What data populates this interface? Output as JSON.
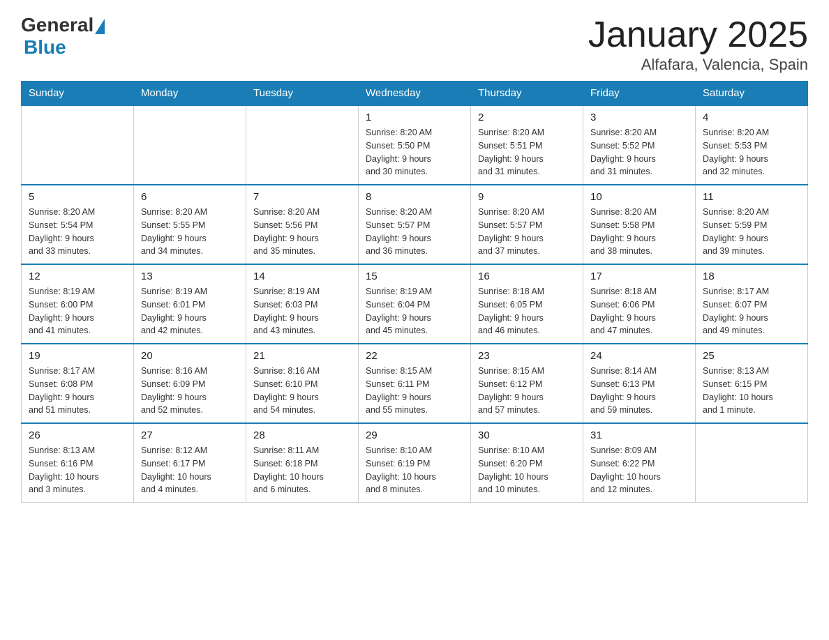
{
  "header": {
    "logo_general": "General",
    "logo_blue": "Blue",
    "title": "January 2025",
    "subtitle": "Alfafara, Valencia, Spain"
  },
  "weekdays": [
    "Sunday",
    "Monday",
    "Tuesday",
    "Wednesday",
    "Thursday",
    "Friday",
    "Saturday"
  ],
  "weeks": [
    [
      {
        "day": "",
        "info": ""
      },
      {
        "day": "",
        "info": ""
      },
      {
        "day": "",
        "info": ""
      },
      {
        "day": "1",
        "info": "Sunrise: 8:20 AM\nSunset: 5:50 PM\nDaylight: 9 hours\nand 30 minutes."
      },
      {
        "day": "2",
        "info": "Sunrise: 8:20 AM\nSunset: 5:51 PM\nDaylight: 9 hours\nand 31 minutes."
      },
      {
        "day": "3",
        "info": "Sunrise: 8:20 AM\nSunset: 5:52 PM\nDaylight: 9 hours\nand 31 minutes."
      },
      {
        "day": "4",
        "info": "Sunrise: 8:20 AM\nSunset: 5:53 PM\nDaylight: 9 hours\nand 32 minutes."
      }
    ],
    [
      {
        "day": "5",
        "info": "Sunrise: 8:20 AM\nSunset: 5:54 PM\nDaylight: 9 hours\nand 33 minutes."
      },
      {
        "day": "6",
        "info": "Sunrise: 8:20 AM\nSunset: 5:55 PM\nDaylight: 9 hours\nand 34 minutes."
      },
      {
        "day": "7",
        "info": "Sunrise: 8:20 AM\nSunset: 5:56 PM\nDaylight: 9 hours\nand 35 minutes."
      },
      {
        "day": "8",
        "info": "Sunrise: 8:20 AM\nSunset: 5:57 PM\nDaylight: 9 hours\nand 36 minutes."
      },
      {
        "day": "9",
        "info": "Sunrise: 8:20 AM\nSunset: 5:57 PM\nDaylight: 9 hours\nand 37 minutes."
      },
      {
        "day": "10",
        "info": "Sunrise: 8:20 AM\nSunset: 5:58 PM\nDaylight: 9 hours\nand 38 minutes."
      },
      {
        "day": "11",
        "info": "Sunrise: 8:20 AM\nSunset: 5:59 PM\nDaylight: 9 hours\nand 39 minutes."
      }
    ],
    [
      {
        "day": "12",
        "info": "Sunrise: 8:19 AM\nSunset: 6:00 PM\nDaylight: 9 hours\nand 41 minutes."
      },
      {
        "day": "13",
        "info": "Sunrise: 8:19 AM\nSunset: 6:01 PM\nDaylight: 9 hours\nand 42 minutes."
      },
      {
        "day": "14",
        "info": "Sunrise: 8:19 AM\nSunset: 6:03 PM\nDaylight: 9 hours\nand 43 minutes."
      },
      {
        "day": "15",
        "info": "Sunrise: 8:19 AM\nSunset: 6:04 PM\nDaylight: 9 hours\nand 45 minutes."
      },
      {
        "day": "16",
        "info": "Sunrise: 8:18 AM\nSunset: 6:05 PM\nDaylight: 9 hours\nand 46 minutes."
      },
      {
        "day": "17",
        "info": "Sunrise: 8:18 AM\nSunset: 6:06 PM\nDaylight: 9 hours\nand 47 minutes."
      },
      {
        "day": "18",
        "info": "Sunrise: 8:17 AM\nSunset: 6:07 PM\nDaylight: 9 hours\nand 49 minutes."
      }
    ],
    [
      {
        "day": "19",
        "info": "Sunrise: 8:17 AM\nSunset: 6:08 PM\nDaylight: 9 hours\nand 51 minutes."
      },
      {
        "day": "20",
        "info": "Sunrise: 8:16 AM\nSunset: 6:09 PM\nDaylight: 9 hours\nand 52 minutes."
      },
      {
        "day": "21",
        "info": "Sunrise: 8:16 AM\nSunset: 6:10 PM\nDaylight: 9 hours\nand 54 minutes."
      },
      {
        "day": "22",
        "info": "Sunrise: 8:15 AM\nSunset: 6:11 PM\nDaylight: 9 hours\nand 55 minutes."
      },
      {
        "day": "23",
        "info": "Sunrise: 8:15 AM\nSunset: 6:12 PM\nDaylight: 9 hours\nand 57 minutes."
      },
      {
        "day": "24",
        "info": "Sunrise: 8:14 AM\nSunset: 6:13 PM\nDaylight: 9 hours\nand 59 minutes."
      },
      {
        "day": "25",
        "info": "Sunrise: 8:13 AM\nSunset: 6:15 PM\nDaylight: 10 hours\nand 1 minute."
      }
    ],
    [
      {
        "day": "26",
        "info": "Sunrise: 8:13 AM\nSunset: 6:16 PM\nDaylight: 10 hours\nand 3 minutes."
      },
      {
        "day": "27",
        "info": "Sunrise: 8:12 AM\nSunset: 6:17 PM\nDaylight: 10 hours\nand 4 minutes."
      },
      {
        "day": "28",
        "info": "Sunrise: 8:11 AM\nSunset: 6:18 PM\nDaylight: 10 hours\nand 6 minutes."
      },
      {
        "day": "29",
        "info": "Sunrise: 8:10 AM\nSunset: 6:19 PM\nDaylight: 10 hours\nand 8 minutes."
      },
      {
        "day": "30",
        "info": "Sunrise: 8:10 AM\nSunset: 6:20 PM\nDaylight: 10 hours\nand 10 minutes."
      },
      {
        "day": "31",
        "info": "Sunrise: 8:09 AM\nSunset: 6:22 PM\nDaylight: 10 hours\nand 12 minutes."
      },
      {
        "day": "",
        "info": ""
      }
    ]
  ]
}
